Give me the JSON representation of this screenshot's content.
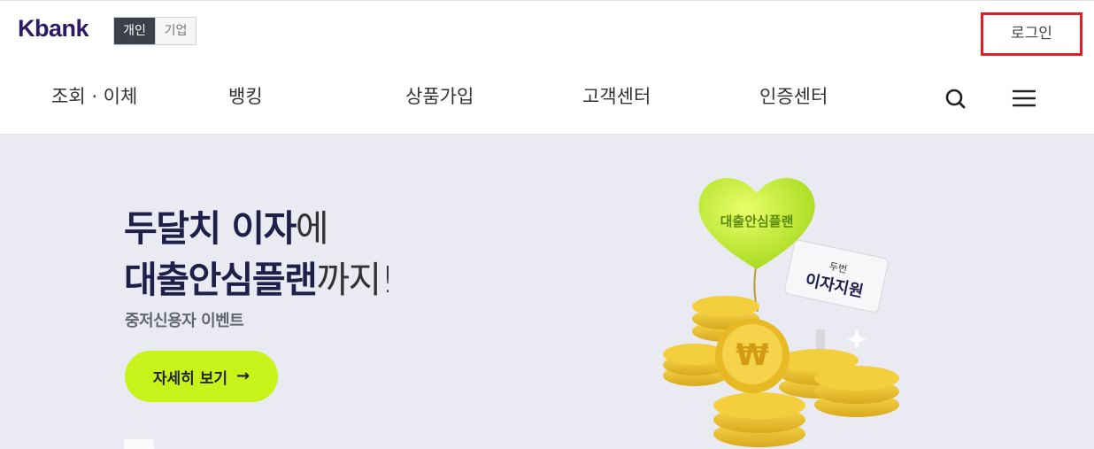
{
  "header": {
    "logo": "Kbank",
    "segment": {
      "personal": "개인",
      "business": "기업"
    },
    "login_label": "로그인"
  },
  "nav": {
    "items": [
      {
        "label": "조회 · 이체"
      },
      {
        "label": "뱅킹"
      },
      {
        "label": "상품가입"
      },
      {
        "label": "고객센터"
      },
      {
        "label": "인증센터"
      }
    ],
    "search_icon": "search-icon",
    "menu_icon": "hamburger-menu-icon"
  },
  "hero": {
    "line1_bold": "두달치 이자",
    "line1_thin": "에",
    "line2_bold": "대출안심플랜",
    "line2_thin": "까지!",
    "subtitle": "중저신용자 이벤트",
    "cta_label": "자세히 보기",
    "cta_arrow": "→",
    "illustration": {
      "balloon_text": "대출안심플랜",
      "sign_small": "두번",
      "sign_big": "이자지원",
      "coin_symbol": "₩"
    },
    "colors": {
      "background": "#eaebf2",
      "accent": "#c7f21a",
      "headline": "#1f1f4a"
    }
  }
}
